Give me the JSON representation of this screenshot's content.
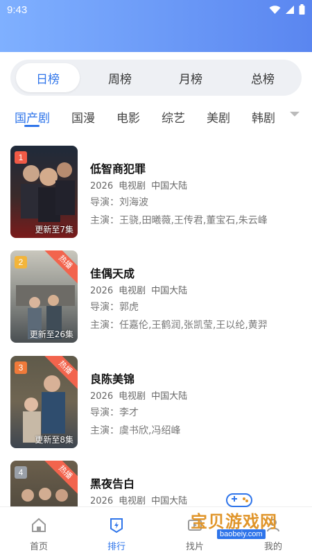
{
  "status": {
    "time": "9:43"
  },
  "period_tabs": [
    "日榜",
    "周榜",
    "月榜",
    "总榜"
  ],
  "category_tabs": [
    "国产剧",
    "国漫",
    "电影",
    "综艺",
    "美剧",
    "韩剧"
  ],
  "list": [
    {
      "rank": "1",
      "title": "低智商犯罪",
      "year": "2026",
      "type": "电视剧",
      "region": "中国大陆",
      "director_label": "导演：",
      "director": "刘海波",
      "cast_label": "主演：",
      "cast": "王骁,田曦薇,王传君,董宝石,朱云峰",
      "episode": "更新至7集",
      "hot": "",
      "poster_color": "#3a2a2a",
      "rank_color": "#f05a46"
    },
    {
      "rank": "2",
      "title": "佳偶天成",
      "year": "2026",
      "type": "电视剧",
      "region": "中国大陆",
      "director_label": "导演：",
      "director": "郭虎",
      "cast_label": "主演：",
      "cast": "任嘉伦,王鹤润,张凯莹,王以纶,黄羿",
      "episode": "更新至26集",
      "hot": "热播",
      "poster_color": "#8d8f8a",
      "rank_color": "#f3b53b"
    },
    {
      "rank": "3",
      "title": "良陈美锦",
      "year": "2026",
      "type": "电视剧",
      "region": "中国大陆",
      "director_label": "导演：",
      "director": "李才",
      "cast_label": "主演：",
      "cast": "虞书欣,冯绍峰",
      "episode": "更新至8集",
      "hot": "热播",
      "poster_color": "#6f6552",
      "rank_color": "#f07a3a"
    },
    {
      "rank": "4",
      "title": "黑夜告白",
      "year": "2026",
      "type": "电视剧",
      "region": "中国大陆",
      "director_label": "",
      "director": "",
      "cast_label": "",
      "cast": "",
      "episode": "",
      "hot": "热播",
      "poster_color": "#3b3833",
      "rank_color": "#9aa0a8"
    }
  ],
  "bottom_nav": [
    "首页",
    "排行",
    "找片",
    "我的"
  ],
  "watermark": {
    "title": "宝贝游戏网",
    "url": "baobeiy.com"
  },
  "colors": {
    "accent": "#2e74ea",
    "hot": "#f2644d"
  }
}
